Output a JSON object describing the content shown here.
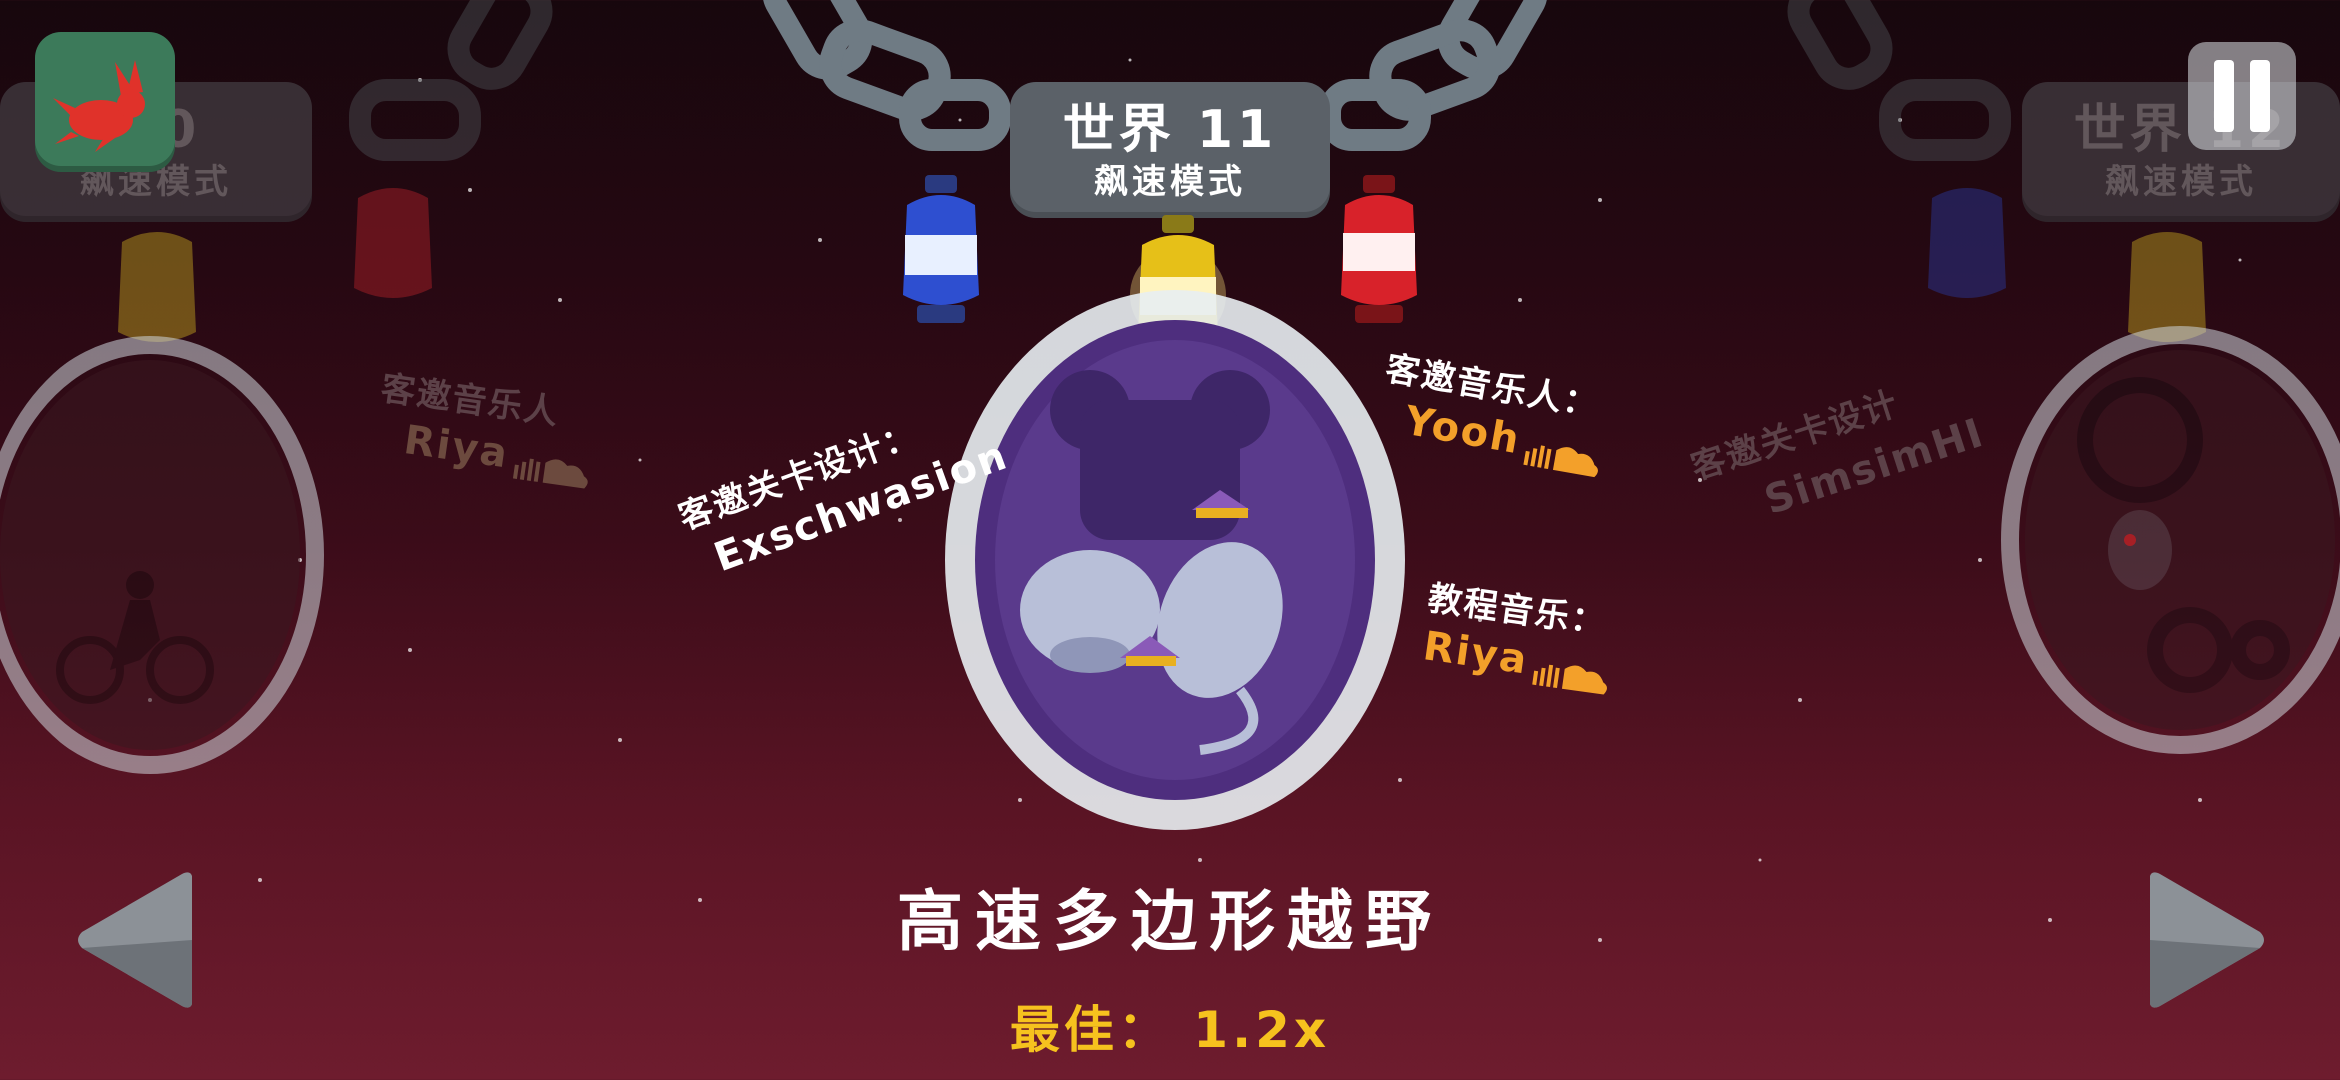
{
  "current_world": {
    "title": "世界 11",
    "mode": "飙速模式"
  },
  "prev_world": {
    "title": "10",
    "mode": "飙速模式"
  },
  "next_world": {
    "title": "世界 12",
    "mode": "飙速模式"
  },
  "level_name": "高速多边形越野",
  "best_record": "最佳： 1.2x",
  "credits_center": {
    "level_design_label": "客邀关卡设计：",
    "level_design_name": "Exschwasion",
    "guest_musician_label": "客邀音乐人：",
    "guest_musician_name": "Yooh",
    "tutorial_music_label": "教程音乐：",
    "tutorial_music_name": "Riya"
  },
  "credits_left": {
    "guest_musician_label": "客邀音乐人",
    "guest_musician_name": "Riya"
  },
  "credits_right": {
    "level_design_label": "客邀关卡设计",
    "level_design_name": "SimsimHI"
  },
  "colors": {
    "accent_orange": "#f3a02a",
    "best_yellow": "#f6c21e",
    "plaque": "#5b6168",
    "portal_purple": "#5b3a8a"
  },
  "icons": [
    "rabbit-speed-icon",
    "pause-icon",
    "left-arrow-icon",
    "right-arrow-icon",
    "soundcloud-icon"
  ]
}
